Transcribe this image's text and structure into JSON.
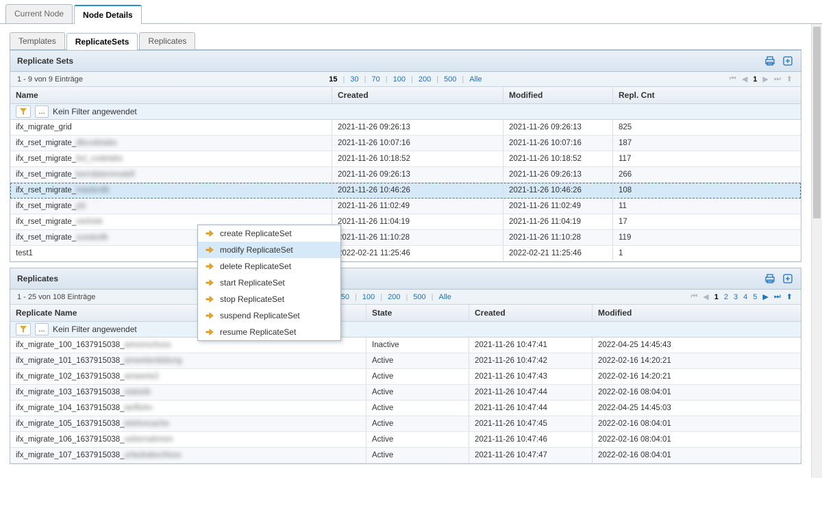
{
  "outer_tabs": {
    "current_node": "Current Node",
    "node_details": "Node Details"
  },
  "inner_tabs": {
    "templates": "Templates",
    "replicatesets": "ReplicateSets",
    "replicates": "Replicates"
  },
  "rsets_panel": {
    "title": "Replicate Sets",
    "range_text": "1 - 9 von 9 Einträge",
    "columns": {
      "name": "Name",
      "created": "Created",
      "modified": "Modified",
      "cnt": "Repl. Cnt"
    },
    "filter_label": "Kein Filter angewendet",
    "filter_dots": "...",
    "pagesizes": {
      "p15": "15",
      "p30": "30",
      "p70": "70",
      "p100": "100",
      "p200": "200",
      "p500": "500",
      "all": "Alle"
    },
    "pager": {
      "page": "1"
    },
    "rows": [
      {
        "name": "ifx_migrate_grid",
        "blur": "",
        "created": "2021-11-26 09:26:13",
        "modified": "2021-11-26 09:26:13",
        "cnt": "825"
      },
      {
        "name": "ifx_rset_migrate_",
        "blur": "dbcodetabs",
        "created": "2021-11-26 10:07:16",
        "modified": "2021-11-26 10:07:16",
        "cnt": "187"
      },
      {
        "name": "ifx_rset_migrate_",
        "blur": "bcl_codetabs",
        "created": "2021-11-26 10:18:52",
        "modified": "2021-11-26 10:18:52",
        "cnt": "117"
      },
      {
        "name": "ifx_rset_migrate_",
        "blur": "kerndatenmodell",
        "created": "2021-11-26 09:26:13",
        "modified": "2021-11-26 09:26:13",
        "cnt": "266"
      },
      {
        "name": "ifx_rset_migrate_",
        "blur": "masterdb",
        "created": "2021-11-26 10:46:26",
        "modified": "2021-11-26 10:46:26",
        "cnt": "108",
        "selected": true
      },
      {
        "name": "ifx_rset_migrate_",
        "blur": "plz",
        "created": "2021-11-26 11:02:49",
        "modified": "2021-11-26 11:02:49",
        "cnt": "11"
      },
      {
        "name": "ifx_rset_migrate_",
        "blur": "vertrieb",
        "created": "2021-11-26 11:04:19",
        "modified": "2021-11-26 11:04:19",
        "cnt": "17"
      },
      {
        "name": "ifx_rset_migrate_",
        "blur": "zusatzdb",
        "created": "2021-11-26 11:10:28",
        "modified": "2021-11-26 11:10:28",
        "cnt": "119"
      },
      {
        "name": "test1",
        "blur": "",
        "created": "2022-02-21 11:25:46",
        "modified": "2022-02-21 11:25:46",
        "cnt": "1"
      }
    ]
  },
  "rep_panel": {
    "title": "Replicates",
    "range_text": "1 - 25 von 108 Einträge",
    "columns": {
      "name": "Replicate Name",
      "state": "State",
      "created": "Created",
      "modified": "Modified"
    },
    "filter_label": "Kein Filter angewendet",
    "filter_dots": "...",
    "pagesizes": {
      "p50": "50",
      "p100": "100",
      "p200": "200",
      "p500": "500",
      "all": "Alle"
    },
    "pager": {
      "p1": "1",
      "p2": "2",
      "p3": "3",
      "p4": "4",
      "p5": "5"
    },
    "rows": [
      {
        "name": "ifx_migrate_100_1637915038_",
        "blur": "amvorschuss",
        "state": "Inactive",
        "created": "2021-11-26 10:47:41",
        "modified": "2022-04-25 14:45:43"
      },
      {
        "name": "ifx_migrate_101_1637915038_",
        "blur": "amweiterbildung",
        "state": "Active",
        "created": "2021-11-26 10:47:42",
        "modified": "2022-02-16 14:20:21"
      },
      {
        "name": "ifx_migrate_102_1637915038_",
        "blur": "amwerte2",
        "state": "Active",
        "created": "2021-11-26 10:47:43",
        "modified": "2022-02-16 14:20:21"
      },
      {
        "name": "ifx_migrate_103_1637915038_",
        "blur": "statistik",
        "state": "Active",
        "created": "2021-11-26 10:47:44",
        "modified": "2022-02-16 08:04:01"
      },
      {
        "name": "ifx_migrate_104_1637915038_",
        "blur": "tariflohn",
        "state": "Active",
        "created": "2021-11-26 10:47:44",
        "modified": "2022-04-25 14:45:03"
      },
      {
        "name": "ifx_migrate_105_1637915038_",
        "blur": "telefoncache",
        "state": "Active",
        "created": "2021-11-26 10:47:45",
        "modified": "2022-02-16 08:04:01"
      },
      {
        "name": "ifx_migrate_106_1637915038_",
        "blur": "uebernahmen",
        "state": "Active",
        "created": "2021-11-26 10:47:46",
        "modified": "2022-02-16 08:04:01"
      },
      {
        "name": "ifx_migrate_107_1637915038_",
        "blur": "urlaubabschluss",
        "state": "Active",
        "created": "2021-11-26 10:47:47",
        "modified": "2022-02-16 08:04:01"
      }
    ]
  },
  "context_menu": {
    "items": [
      {
        "label": "create ReplicateSet"
      },
      {
        "label": "modify ReplicateSet",
        "hovered": true
      },
      {
        "label": "delete ReplicateSet"
      },
      {
        "label": "start ReplicateSet"
      },
      {
        "label": "stop ReplicateSet"
      },
      {
        "label": "suspend ReplicateSet"
      },
      {
        "label": "resume ReplicateSet"
      }
    ]
  }
}
